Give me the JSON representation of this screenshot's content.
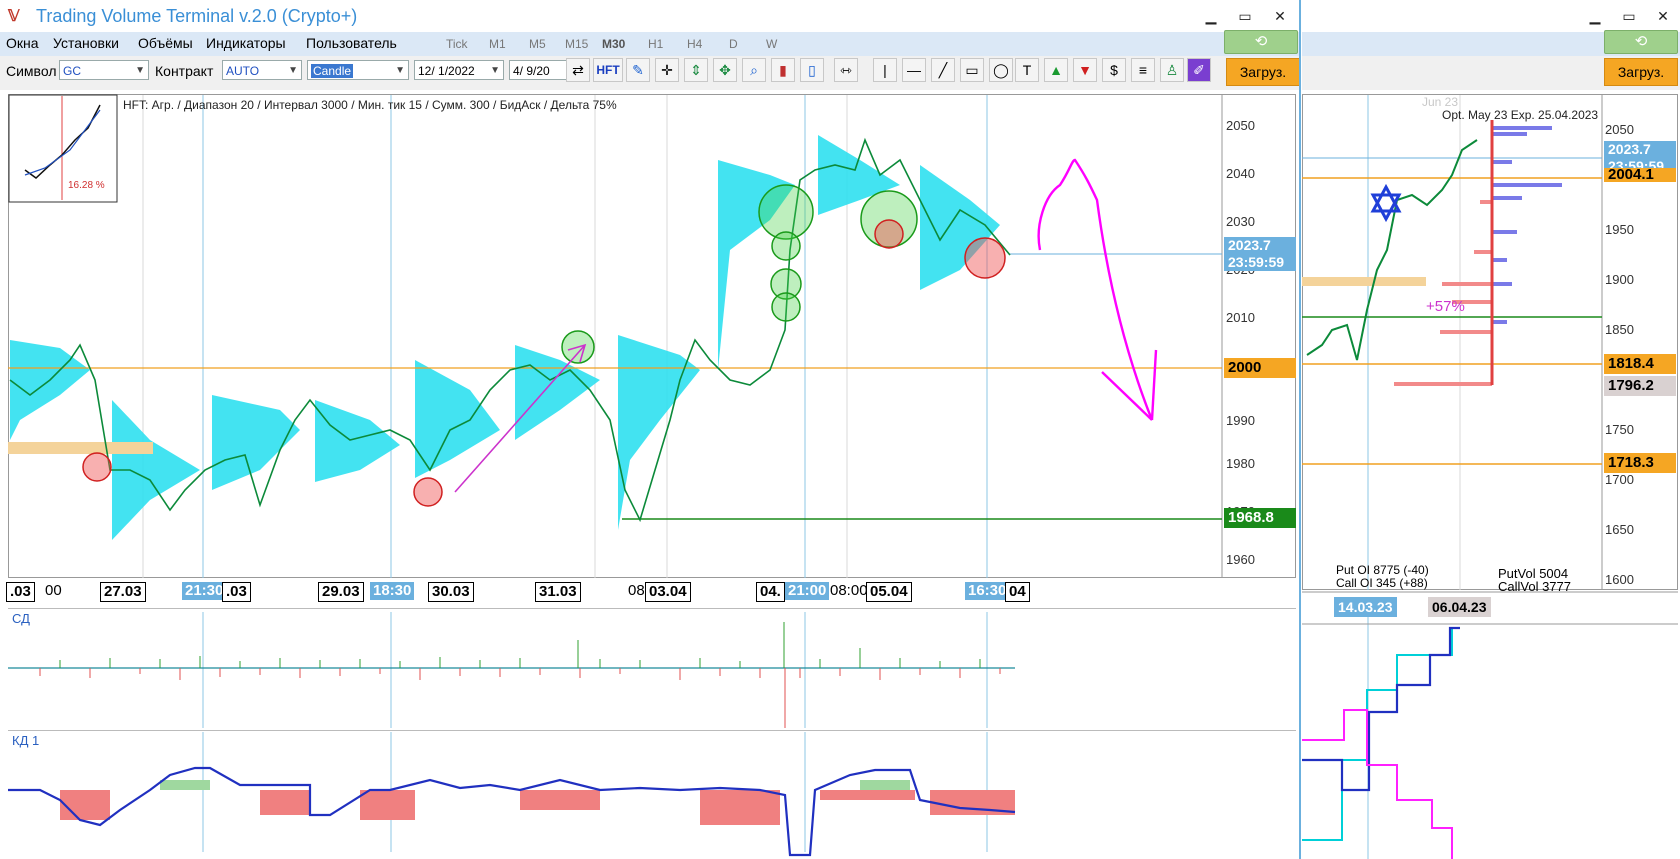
{
  "window": {
    "title": "Trading Volume Terminal v.2.0 (Crypto+)",
    "logo": "𝕍",
    "controls": {
      "minimize": "▁",
      "maximize": "▭",
      "close": "✕"
    }
  },
  "menu": {
    "items": [
      "Окна",
      "Установки",
      "Объёмы",
      "Индикаторы",
      "Пользователь"
    ],
    "timeframes": [
      "Tick",
      "M1",
      "M5",
      "M15",
      "M30",
      "H1",
      "H4",
      "D",
      "W"
    ],
    "active_timeframe": "M30"
  },
  "toolbar": {
    "symbol_label": "Символ",
    "symbol_value": "GC",
    "contract_label": "Контракт",
    "contract_value": "AUTO",
    "chart_type": "Candle",
    "date_from": "12/ 1/2022",
    "date_to": "4/ 9/20",
    "hft_label": "HFT",
    "load_button": "Загруз.",
    "text_tool": "T",
    "dollar_tool": "$"
  },
  "main_chart": {
    "info_line": "HFT: Агр. / Диапазон 20 / Интервал 3000 / Мин. тик 15 / Сумм. 300 / БидАск / Дельта 75%",
    "mini_pct": "16.28 %",
    "price_axis": [
      "2050",
      "2040",
      "2030",
      "2020",
      "2010",
      "2000",
      "1990",
      "1980",
      "1970",
      "1960"
    ],
    "current_price": "2023.7",
    "current_time": "23:59:59",
    "level_2000": "2000",
    "level_green": "1968.8",
    "time_labels": [
      {
        "text": ".03",
        "style": "box"
      },
      {
        "text": "00",
        "style": "plain"
      },
      {
        "text": "27.03",
        "style": "box"
      },
      {
        "text": "21:30",
        "style": "blue"
      },
      {
        "text": ".03",
        "style": "box"
      },
      {
        "text": "29.03",
        "style": "box"
      },
      {
        "text": "18:30",
        "style": "blue"
      },
      {
        "text": "30.03",
        "style": "box"
      },
      {
        "text": "31.03",
        "style": "box"
      },
      {
        "text": "08",
        "style": "plain"
      },
      {
        "text": "03.04",
        "style": "box"
      },
      {
        "text": "04.",
        "style": "box"
      },
      {
        "text": "21:00",
        "style": "blue"
      },
      {
        "text": "08:00",
        "style": "plain"
      },
      {
        "text": "05.04",
        "style": "box"
      },
      {
        "text": "16:30",
        "style": "blue"
      },
      {
        "text": "04",
        "style": "box"
      }
    ]
  },
  "indicators": {
    "cd_label": "СД",
    "kd_label": "КД 1"
  },
  "right_chart": {
    "options_label": "Opt. May 23 Exp. 25.04.2023",
    "faded_label": "Jun 23",
    "price_axis": [
      "2050",
      "2000",
      "1950",
      "1900",
      "1850",
      "1800",
      "1750",
      "1700",
      "1650",
      "1600"
    ],
    "current_price": "2023.7",
    "current_time": "23:59:59",
    "level_top": "2004.1",
    "level_1": "1818.4",
    "level_2": "1796.2",
    "level_3": "1718.3",
    "pct_label": "+57%",
    "put_oi": "Put  OI  8775 (-40)",
    "call_oi": "Call  OI  345 (+88)",
    "put_vol": "PutVol  5004",
    "call_vol": "CallVol  3777",
    "date_left": "14.03.23",
    "date_right": "06.04.23"
  },
  "colors": {
    "accent": "#3a8fd6",
    "load_orange": "#f5a623",
    "green_btn": "#9fd08c",
    "cyan_profile": "#2fe0f0",
    "magenta": "#ff00ff",
    "price_blue": "#6bb0de"
  }
}
